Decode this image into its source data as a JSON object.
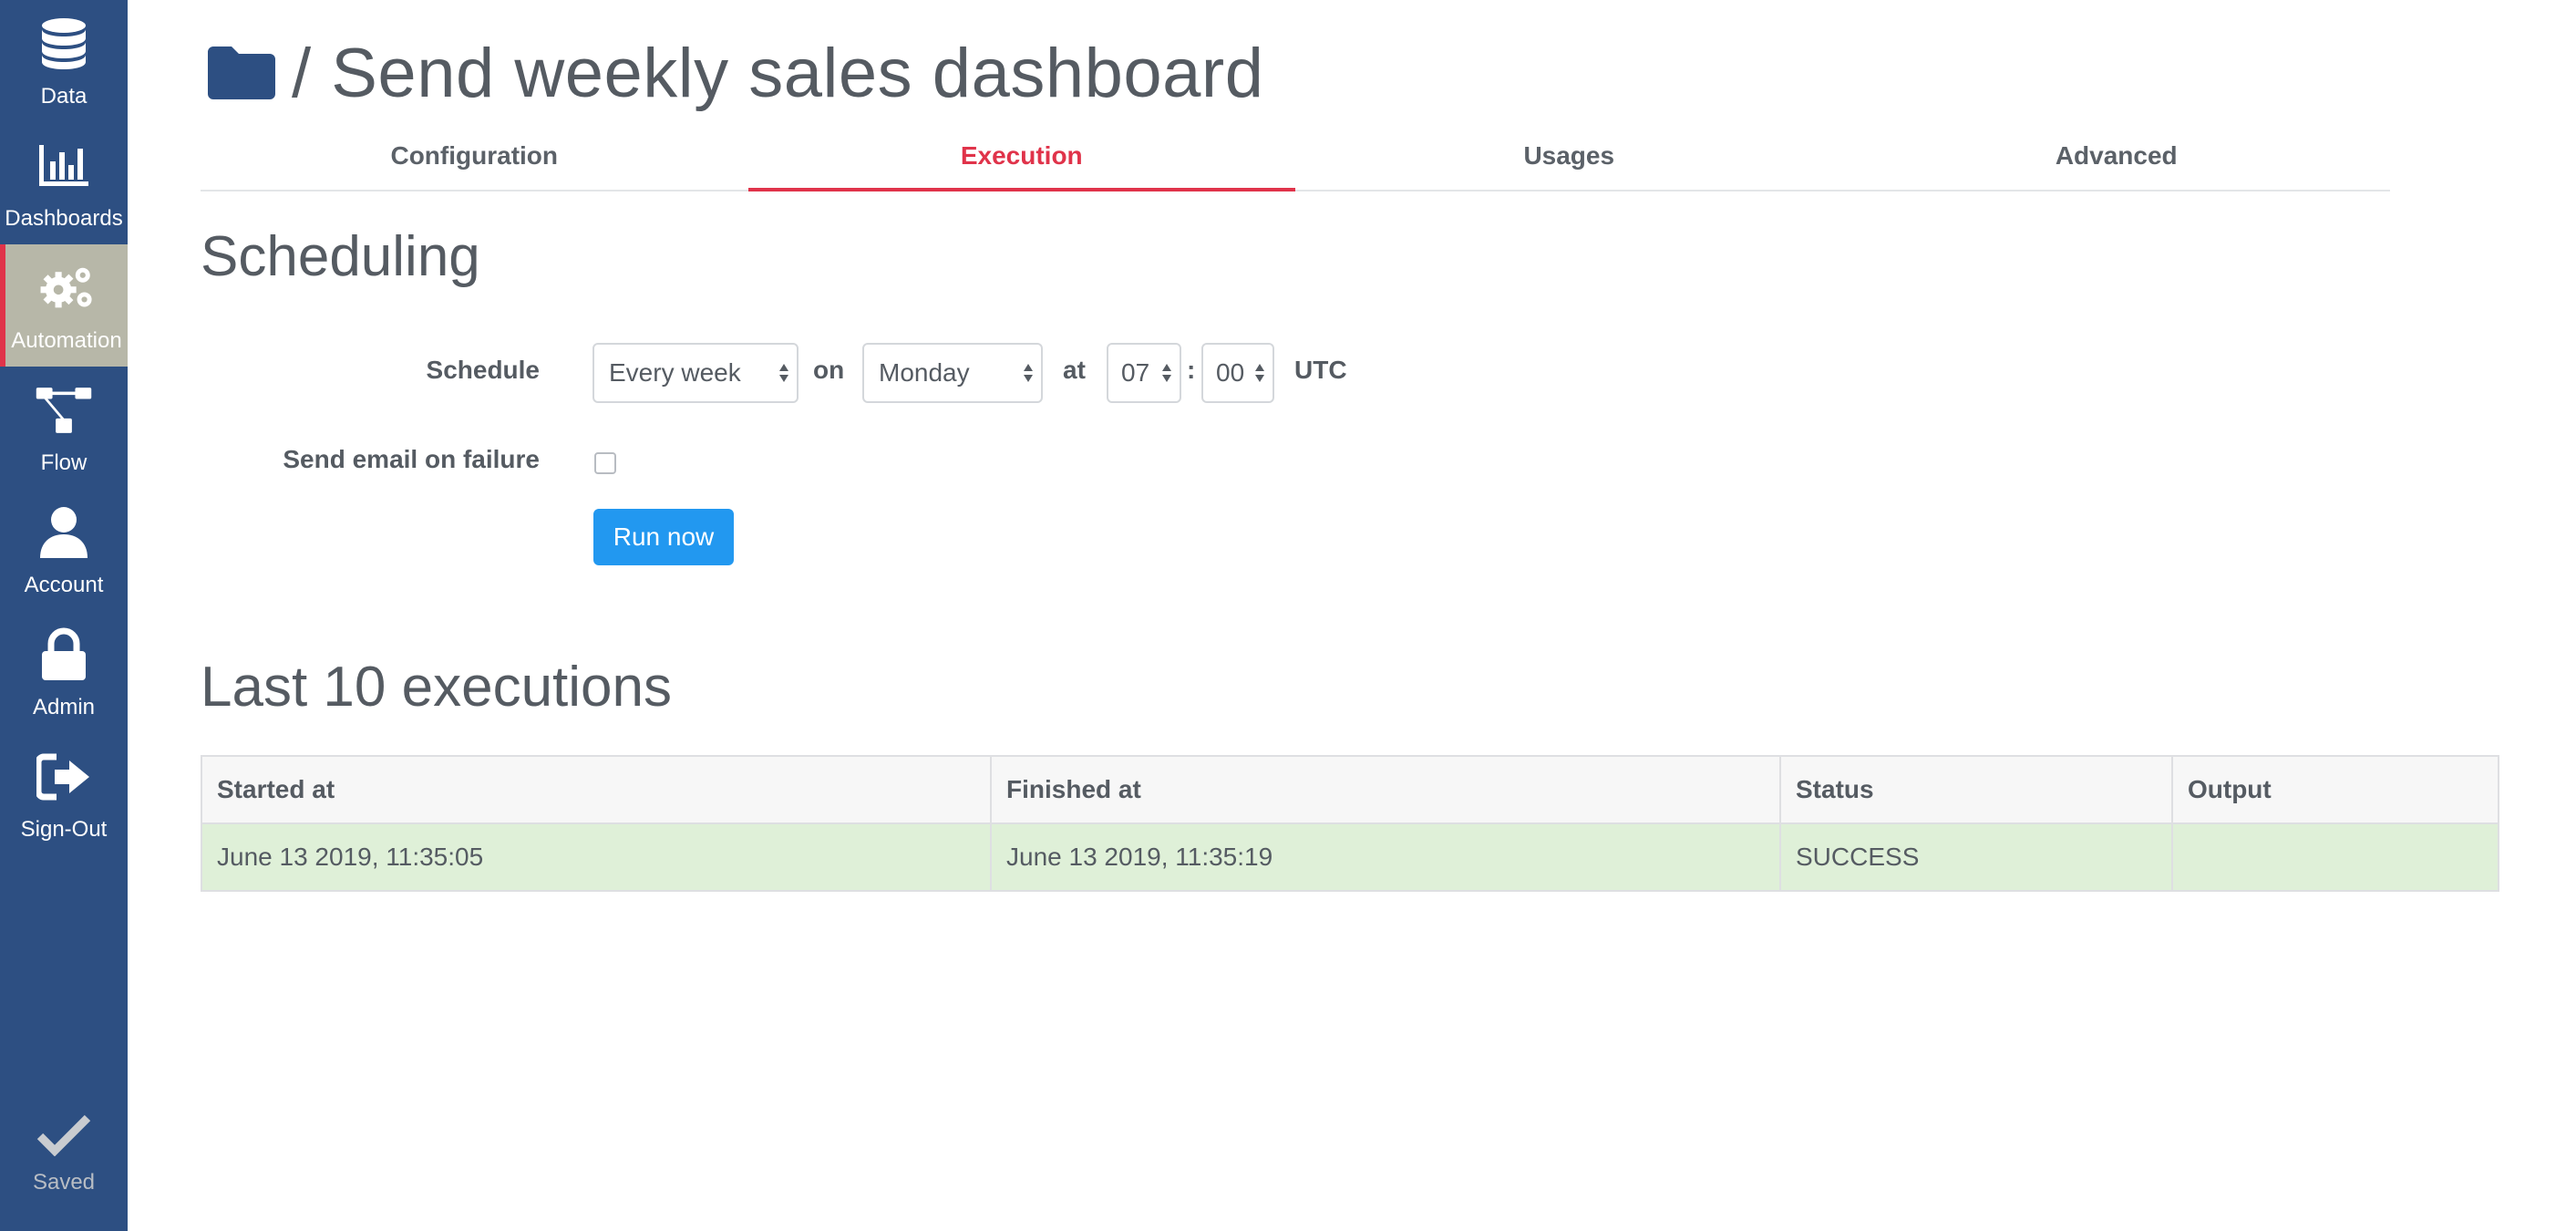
{
  "sidebar": {
    "items": [
      {
        "label": "Data",
        "icon": "database-icon"
      },
      {
        "label": "Dashboards",
        "icon": "bar-chart-icon"
      },
      {
        "label": "Automation",
        "icon": "gears-icon",
        "active": true
      },
      {
        "label": "Flow",
        "icon": "flow-icon"
      },
      {
        "label": "Account",
        "icon": "user-icon"
      },
      {
        "label": "Admin",
        "icon": "lock-icon"
      },
      {
        "label": "Sign-Out",
        "icon": "sign-out-icon"
      }
    ],
    "saved_label": "Saved"
  },
  "header": {
    "title": "/ Send weekly sales dashboard"
  },
  "tabs": [
    {
      "label": "Configuration"
    },
    {
      "label": "Execution",
      "active": true
    },
    {
      "label": "Usages"
    },
    {
      "label": "Advanced"
    }
  ],
  "scheduling": {
    "heading": "Scheduling",
    "schedule_label": "Schedule",
    "frequency": "Every week",
    "on_word": "on",
    "day": "Monday",
    "at_word": "at",
    "hour": "07",
    "colon": ":",
    "minute": "00",
    "timezone": "UTC",
    "email_label": "Send email on failure",
    "email_checked": false,
    "run_button": "Run now"
  },
  "executions": {
    "heading": "Last 10 executions",
    "columns": [
      "Started at",
      "Finished at",
      "Status",
      "Output"
    ],
    "rows": [
      {
        "started": "June 13 2019, 11:35:05",
        "finished": "June 13 2019, 11:35:19",
        "status": "SUCCESS",
        "output": ""
      }
    ]
  },
  "colors": {
    "sidebar": "#2d4f82",
    "accent": "#e0334a",
    "button": "#2298f0",
    "success_row": "#dff0d8"
  }
}
